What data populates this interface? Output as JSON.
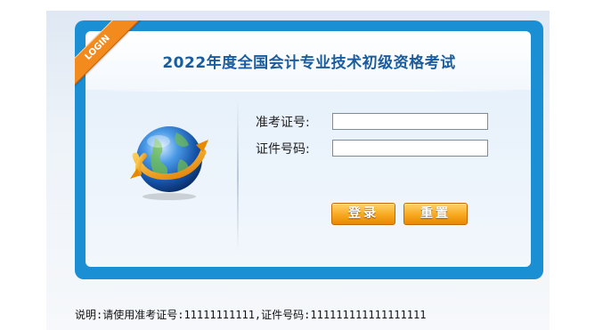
{
  "login": {
    "ribbon_label": "LOGIN",
    "title": "2022年度全国会计专业技术初级资格考试",
    "admission_label": "准考证号:",
    "admission_value": "",
    "id_label": "证件号码:",
    "id_value": "",
    "login_button": "登录",
    "reset_button": "重置"
  },
  "note": "说明:请使用准考证号:11111111111,证件号码:111111111111111111",
  "colors": {
    "frame": "#1b8fd3",
    "title": "#1a5c9d",
    "ribbon": "#f28a1d",
    "button": "#f7a81e"
  },
  "icons": {
    "globe": "globe-arrow-icon"
  }
}
